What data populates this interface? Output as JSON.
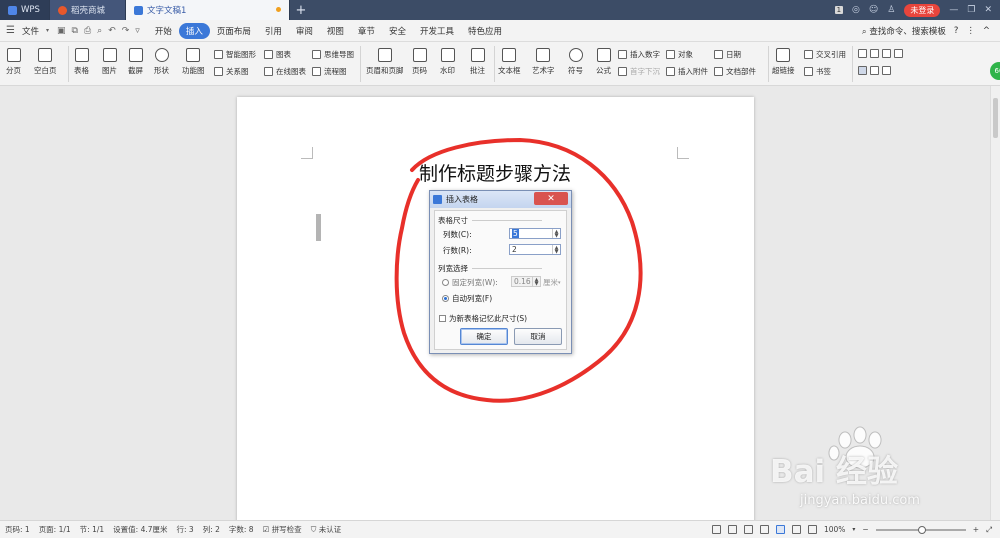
{
  "titlebar": {
    "tabs": [
      {
        "label": "WPS"
      },
      {
        "label": "稻壳商城"
      },
      {
        "label": "文字文稿1"
      }
    ],
    "badge": "1",
    "login_label": "未登录"
  },
  "menu": {
    "file_label": "文件",
    "items": [
      "开始",
      "插入",
      "页面布局",
      "引用",
      "审阅",
      "视图",
      "章节",
      "安全",
      "开发工具",
      "特色应用"
    ],
    "search_label": "查找命令、搜索模板"
  },
  "ribbon": {
    "page_break": "分页",
    "blank_page": "空白页",
    "table": "表格",
    "picture": "图片",
    "screenshot": "截屏",
    "shape": "形状",
    "function_chart": "功能图",
    "smart_shape": "智能图形",
    "chart": "图表",
    "mind_map": "思维导图",
    "relation_chart": "关系图",
    "online_chart": "在线图表",
    "flowchart": "流程图",
    "header_footer": "页眉和页脚",
    "page_number": "页码",
    "watermark": "水印",
    "comment": "批注",
    "textbox": "文本框",
    "wordart": "艺术字",
    "symbol": "符号",
    "formula": "公式",
    "insert_number": "插入数字",
    "first_drop": "首字下沉",
    "object": "对象",
    "attachment": "插入附件",
    "date": "日期",
    "doc_parts": "文档部件",
    "hyperlink": "超链接",
    "cross_ref": "交叉引用",
    "bookmark": "书签"
  },
  "document": {
    "title": "制作标题步骤方法"
  },
  "dialog": {
    "title": "插入表格",
    "section_size": "表格尺寸",
    "columns_label": "列数(C):",
    "columns_value": "5",
    "rows_label": "行数(R):",
    "rows_value": "2",
    "section_width": "列宽选择",
    "fixed_width_label": "固定列宽(W):",
    "fixed_width_value": "0.16",
    "unit": "厘米",
    "auto_width_label": "自动列宽(F)",
    "remember_label": "为新表格记忆此尺寸(S)",
    "ok_label": "确定",
    "cancel_label": "取消"
  },
  "statusbar": {
    "page_num": "页码: 1",
    "pages": "页面: 1/1",
    "section": "节: 1/1",
    "setting": "设置值: 4.7厘米",
    "row": "行: 3",
    "col": "列: 2",
    "words": "字数: 8",
    "spellcheck": "拼写检查",
    "cert": "未认证",
    "zoom": "100%"
  },
  "watermark_brand": {
    "text": "Bai 经验",
    "url": "jingyan.baidu.com"
  },
  "colors": {
    "accent": "#3b78d8",
    "annotation": "#e8302a",
    "login": "#e8453c"
  }
}
